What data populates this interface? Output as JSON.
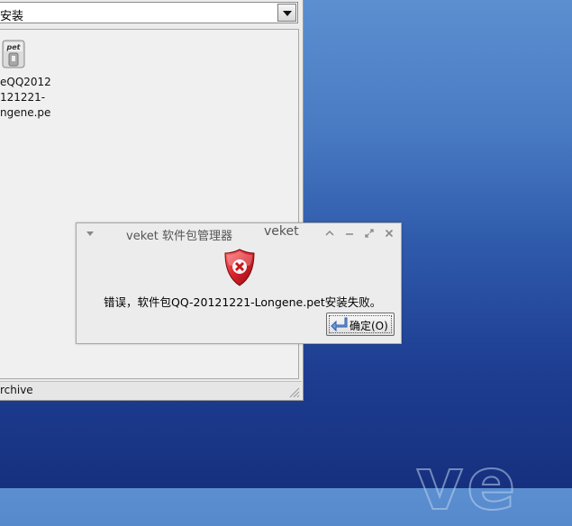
{
  "background": {
    "logo_text": "ve"
  },
  "file_manager": {
    "combo_value": "安装",
    "file": {
      "icon_badge": "pet",
      "name_lines": "eQQ2012\n121221-\nngene.pe"
    },
    "status_text": "rchive"
  },
  "dialog": {
    "title": "veket 软件包管理器",
    "app_name": "veket",
    "message": "错误，软件包QQ-20121221-Longene.pet安装失败。",
    "ok_label": "确定(O)"
  },
  "colors": {
    "error_red": "#d8222a",
    "desktop_blue": "#2f5aab"
  }
}
